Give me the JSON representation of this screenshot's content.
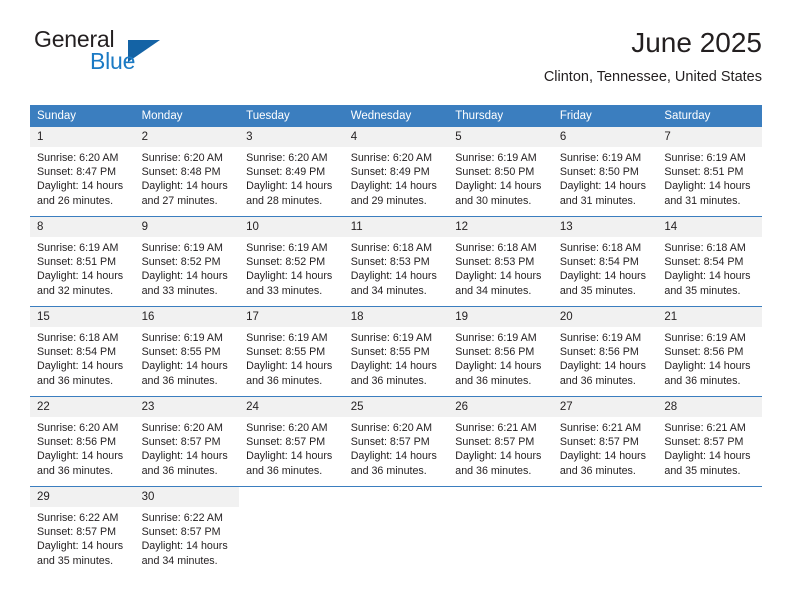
{
  "brand": {
    "word_one": "General",
    "word_two": "Blue",
    "triangle_icon": "brand-triangle-icon",
    "accent_color": "#1b7ac4"
  },
  "header": {
    "title": "June 2025",
    "location": "Clinton, Tennessee, United States"
  },
  "theme": {
    "header_blue": "#3b7ebf",
    "daynum_gray": "#f1f1f1",
    "text": "#231f20"
  },
  "calendar": {
    "weekday_headers": [
      "Sunday",
      "Monday",
      "Tuesday",
      "Wednesday",
      "Thursday",
      "Friday",
      "Saturday"
    ],
    "weeks": [
      [
        {
          "day": "1",
          "sunrise": "Sunrise: 6:20 AM",
          "sunset": "Sunset: 8:47 PM",
          "daylight_1": "Daylight: 14 hours",
          "daylight_2": "and 26 minutes."
        },
        {
          "day": "2",
          "sunrise": "Sunrise: 6:20 AM",
          "sunset": "Sunset: 8:48 PM",
          "daylight_1": "Daylight: 14 hours",
          "daylight_2": "and 27 minutes."
        },
        {
          "day": "3",
          "sunrise": "Sunrise: 6:20 AM",
          "sunset": "Sunset: 8:49 PM",
          "daylight_1": "Daylight: 14 hours",
          "daylight_2": "and 28 minutes."
        },
        {
          "day": "4",
          "sunrise": "Sunrise: 6:20 AM",
          "sunset": "Sunset: 8:49 PM",
          "daylight_1": "Daylight: 14 hours",
          "daylight_2": "and 29 minutes."
        },
        {
          "day": "5",
          "sunrise": "Sunrise: 6:19 AM",
          "sunset": "Sunset: 8:50 PM",
          "daylight_1": "Daylight: 14 hours",
          "daylight_2": "and 30 minutes."
        },
        {
          "day": "6",
          "sunrise": "Sunrise: 6:19 AM",
          "sunset": "Sunset: 8:50 PM",
          "daylight_1": "Daylight: 14 hours",
          "daylight_2": "and 31 minutes."
        },
        {
          "day": "7",
          "sunrise": "Sunrise: 6:19 AM",
          "sunset": "Sunset: 8:51 PM",
          "daylight_1": "Daylight: 14 hours",
          "daylight_2": "and 31 minutes."
        }
      ],
      [
        {
          "day": "8",
          "sunrise": "Sunrise: 6:19 AM",
          "sunset": "Sunset: 8:51 PM",
          "daylight_1": "Daylight: 14 hours",
          "daylight_2": "and 32 minutes."
        },
        {
          "day": "9",
          "sunrise": "Sunrise: 6:19 AM",
          "sunset": "Sunset: 8:52 PM",
          "daylight_1": "Daylight: 14 hours",
          "daylight_2": "and 33 minutes."
        },
        {
          "day": "10",
          "sunrise": "Sunrise: 6:19 AM",
          "sunset": "Sunset: 8:52 PM",
          "daylight_1": "Daylight: 14 hours",
          "daylight_2": "and 33 minutes."
        },
        {
          "day": "11",
          "sunrise": "Sunrise: 6:18 AM",
          "sunset": "Sunset: 8:53 PM",
          "daylight_1": "Daylight: 14 hours",
          "daylight_2": "and 34 minutes."
        },
        {
          "day": "12",
          "sunrise": "Sunrise: 6:18 AM",
          "sunset": "Sunset: 8:53 PM",
          "daylight_1": "Daylight: 14 hours",
          "daylight_2": "and 34 minutes."
        },
        {
          "day": "13",
          "sunrise": "Sunrise: 6:18 AM",
          "sunset": "Sunset: 8:54 PM",
          "daylight_1": "Daylight: 14 hours",
          "daylight_2": "and 35 minutes."
        },
        {
          "day": "14",
          "sunrise": "Sunrise: 6:18 AM",
          "sunset": "Sunset: 8:54 PM",
          "daylight_1": "Daylight: 14 hours",
          "daylight_2": "and 35 minutes."
        }
      ],
      [
        {
          "day": "15",
          "sunrise": "Sunrise: 6:18 AM",
          "sunset": "Sunset: 8:54 PM",
          "daylight_1": "Daylight: 14 hours",
          "daylight_2": "and 36 minutes."
        },
        {
          "day": "16",
          "sunrise": "Sunrise: 6:19 AM",
          "sunset": "Sunset: 8:55 PM",
          "daylight_1": "Daylight: 14 hours",
          "daylight_2": "and 36 minutes."
        },
        {
          "day": "17",
          "sunrise": "Sunrise: 6:19 AM",
          "sunset": "Sunset: 8:55 PM",
          "daylight_1": "Daylight: 14 hours",
          "daylight_2": "and 36 minutes."
        },
        {
          "day": "18",
          "sunrise": "Sunrise: 6:19 AM",
          "sunset": "Sunset: 8:55 PM",
          "daylight_1": "Daylight: 14 hours",
          "daylight_2": "and 36 minutes."
        },
        {
          "day": "19",
          "sunrise": "Sunrise: 6:19 AM",
          "sunset": "Sunset: 8:56 PM",
          "daylight_1": "Daylight: 14 hours",
          "daylight_2": "and 36 minutes."
        },
        {
          "day": "20",
          "sunrise": "Sunrise: 6:19 AM",
          "sunset": "Sunset: 8:56 PM",
          "daylight_1": "Daylight: 14 hours",
          "daylight_2": "and 36 minutes."
        },
        {
          "day": "21",
          "sunrise": "Sunrise: 6:19 AM",
          "sunset": "Sunset: 8:56 PM",
          "daylight_1": "Daylight: 14 hours",
          "daylight_2": "and 36 minutes."
        }
      ],
      [
        {
          "day": "22",
          "sunrise": "Sunrise: 6:20 AM",
          "sunset": "Sunset: 8:56 PM",
          "daylight_1": "Daylight: 14 hours",
          "daylight_2": "and 36 minutes."
        },
        {
          "day": "23",
          "sunrise": "Sunrise: 6:20 AM",
          "sunset": "Sunset: 8:57 PM",
          "daylight_1": "Daylight: 14 hours",
          "daylight_2": "and 36 minutes."
        },
        {
          "day": "24",
          "sunrise": "Sunrise: 6:20 AM",
          "sunset": "Sunset: 8:57 PM",
          "daylight_1": "Daylight: 14 hours",
          "daylight_2": "and 36 minutes."
        },
        {
          "day": "25",
          "sunrise": "Sunrise: 6:20 AM",
          "sunset": "Sunset: 8:57 PM",
          "daylight_1": "Daylight: 14 hours",
          "daylight_2": "and 36 minutes."
        },
        {
          "day": "26",
          "sunrise": "Sunrise: 6:21 AM",
          "sunset": "Sunset: 8:57 PM",
          "daylight_1": "Daylight: 14 hours",
          "daylight_2": "and 36 minutes."
        },
        {
          "day": "27",
          "sunrise": "Sunrise: 6:21 AM",
          "sunset": "Sunset: 8:57 PM",
          "daylight_1": "Daylight: 14 hours",
          "daylight_2": "and 36 minutes."
        },
        {
          "day": "28",
          "sunrise": "Sunrise: 6:21 AM",
          "sunset": "Sunset: 8:57 PM",
          "daylight_1": "Daylight: 14 hours",
          "daylight_2": "and 35 minutes."
        }
      ],
      [
        {
          "day": "29",
          "sunrise": "Sunrise: 6:22 AM",
          "sunset": "Sunset: 8:57 PM",
          "daylight_1": "Daylight: 14 hours",
          "daylight_2": "and 35 minutes."
        },
        {
          "day": "30",
          "sunrise": "Sunrise: 6:22 AM",
          "sunset": "Sunset: 8:57 PM",
          "daylight_1": "Daylight: 14 hours",
          "daylight_2": "and 34 minutes."
        },
        {
          "day": "",
          "sunrise": "",
          "sunset": "",
          "daylight_1": "",
          "daylight_2": ""
        },
        {
          "day": "",
          "sunrise": "",
          "sunset": "",
          "daylight_1": "",
          "daylight_2": ""
        },
        {
          "day": "",
          "sunrise": "",
          "sunset": "",
          "daylight_1": "",
          "daylight_2": ""
        },
        {
          "day": "",
          "sunrise": "",
          "sunset": "",
          "daylight_1": "",
          "daylight_2": ""
        },
        {
          "day": "",
          "sunrise": "",
          "sunset": "",
          "daylight_1": "",
          "daylight_2": ""
        }
      ]
    ]
  }
}
